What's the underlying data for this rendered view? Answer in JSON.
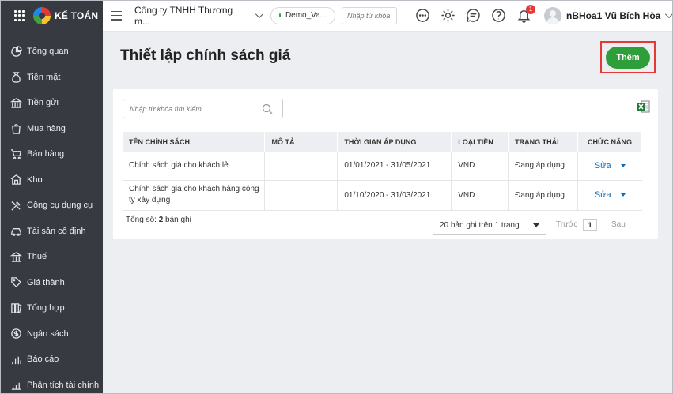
{
  "app": {
    "brand": "KẾ TOÁN"
  },
  "sidebar": {
    "items": [
      {
        "label": "Tổng quan",
        "icon": "dashboard-icon"
      },
      {
        "label": "Tiền mặt",
        "icon": "money-bag-icon"
      },
      {
        "label": "Tiền gửi",
        "icon": "bank-icon"
      },
      {
        "label": "Mua hàng",
        "icon": "shopping-bag-icon"
      },
      {
        "label": "Bán hàng",
        "icon": "cart-icon"
      },
      {
        "label": "Kho",
        "icon": "warehouse-icon"
      },
      {
        "label": "Công cụ dụng cụ",
        "icon": "tools-icon"
      },
      {
        "label": "Tài sản cố định",
        "icon": "car-icon"
      },
      {
        "label": "Thuế",
        "icon": "tax-icon"
      },
      {
        "label": "Giá thành",
        "icon": "price-tag-icon"
      },
      {
        "label": "Tổng hợp",
        "icon": "books-icon"
      },
      {
        "label": "Ngân sách",
        "icon": "budget-icon"
      },
      {
        "label": "Báo cáo",
        "icon": "bar-chart-icon"
      },
      {
        "label": "Phân tích tài chính",
        "icon": "analysis-icon"
      }
    ]
  },
  "topbar": {
    "company": "Công ty TNHH Thương m...",
    "database": "Demo_Va...",
    "search_placeholder": "Nhập từ khóa",
    "notification_count": "1",
    "user_name": "nBHoa1 Vũ Bích Hòa"
  },
  "page": {
    "title": "Thiết lập chính sách giá",
    "add_button": "Thêm",
    "search_placeholder": "Nhập từ khóa tìm kiếm"
  },
  "table": {
    "headers": [
      "TÊN CHÍNH SÁCH",
      "MÔ TẢ",
      "THỜI GIAN ÁP DỤNG",
      "LOẠI TIỀN",
      "TRẠNG THÁI",
      "CHỨC NĂNG"
    ],
    "rows": [
      {
        "name": "Chính sách giá cho khách lẻ",
        "description": "",
        "period": "01/01/2021 - 31/05/2021",
        "currency": "VND",
        "status": "Đang áp dụng",
        "action": "Sửa"
      },
      {
        "name": "Chính sách giá cho khách hàng công ty xây dựng",
        "description": "",
        "period": "01/10/2020 - 31/03/2021",
        "currency": "VND",
        "status": "Đang áp dụng",
        "action": "Sửa"
      }
    ]
  },
  "footer": {
    "total_label": "Tổng số:",
    "total_count": "2",
    "total_unit": "bản ghi",
    "page_size": "20 bản ghi trên 1 trang",
    "prev": "Trước",
    "page_number": "1",
    "next": "Sau"
  },
  "colors": {
    "sidebar": "#373b41",
    "primary_green": "#2e9e3a",
    "highlight_red": "#e53935",
    "link_blue": "#0b6ebd"
  }
}
